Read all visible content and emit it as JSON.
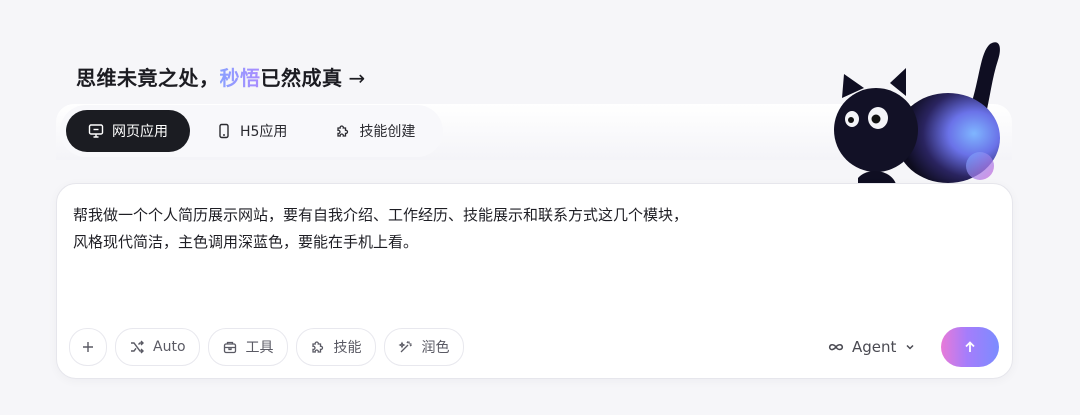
{
  "headline": {
    "part1": "思维未竟之处，",
    "accent": "秒悟",
    "part2": "已然成真",
    "arrow": "→"
  },
  "tabs": [
    {
      "label": "网页应用",
      "icon": "monitor-icon",
      "active": true
    },
    {
      "label": "H5应用",
      "icon": "phone-icon",
      "active": false
    },
    {
      "label": "技能创建",
      "icon": "puzzle-icon",
      "active": false
    }
  ],
  "prompt": {
    "line1": "帮我做一个个人简历展示网站，要有自我介绍、工作经历、技能展示和联系方式这几个模块，",
    "line2": "风格现代简洁，主色调用深蓝色，要能在手机上看。"
  },
  "toolbar": {
    "add_icon": "plus-icon",
    "auto_label": "Auto",
    "tools_label": "工具",
    "skills_label": "技能",
    "polish_label": "润色"
  },
  "agent": {
    "label": "Agent",
    "icon": "infinity-icon"
  },
  "send": {
    "icon": "arrow-up-icon"
  },
  "colors": {
    "active_tab_bg": "#1b1c22",
    "accent_start": "#8aa0ff",
    "accent_end": "#a98bff",
    "send_gradient": [
      "#e87ad8",
      "#a57dfb",
      "#7b8cff"
    ]
  }
}
